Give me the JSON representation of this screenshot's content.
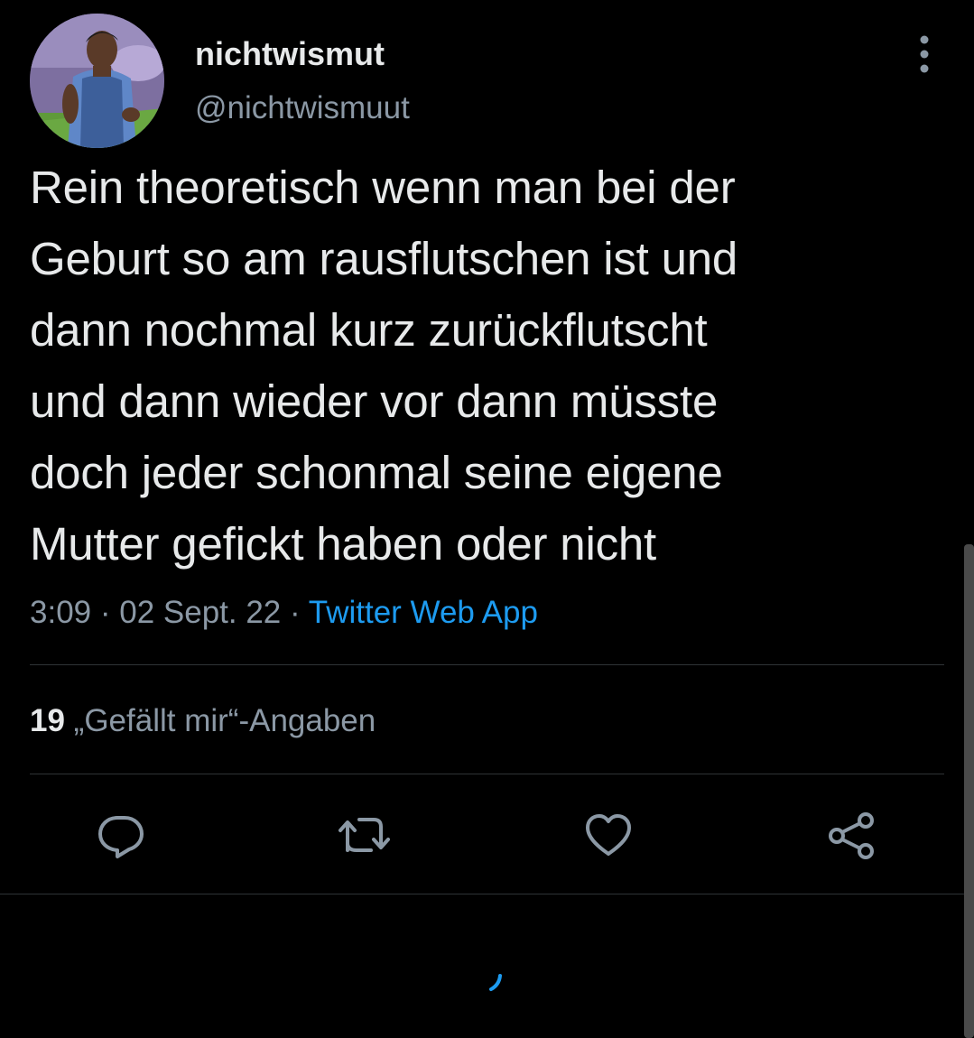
{
  "user": {
    "display_name": "nichtwismut",
    "handle": "@nichtwismuut"
  },
  "tweet": {
    "text": "Rein theoretisch wenn man bei der\nGeburt so am rausflutschen ist und\ndann nochmal kurz zurückflutscht\nund dann wieder vor dann müsste\ndoch jeder schonmal seine eigene\nMutter gefickt haben oder nicht",
    "time": "3:09",
    "separator": " · ",
    "date": "02 Sept. 22",
    "source": "Twitter Web App"
  },
  "stats": {
    "likes_count": "19",
    "likes_label": "„Gefällt mir“-Angaben"
  },
  "actions": [
    {
      "icon": "reply-icon"
    },
    {
      "icon": "retweet-icon"
    },
    {
      "icon": "like-icon"
    },
    {
      "icon": "share-icon"
    }
  ],
  "colors": {
    "background": "#000000",
    "text": "#e7e9ea",
    "secondary": "#8b98a5",
    "accent": "#1d9bf0",
    "divider": "#2f3336"
  }
}
